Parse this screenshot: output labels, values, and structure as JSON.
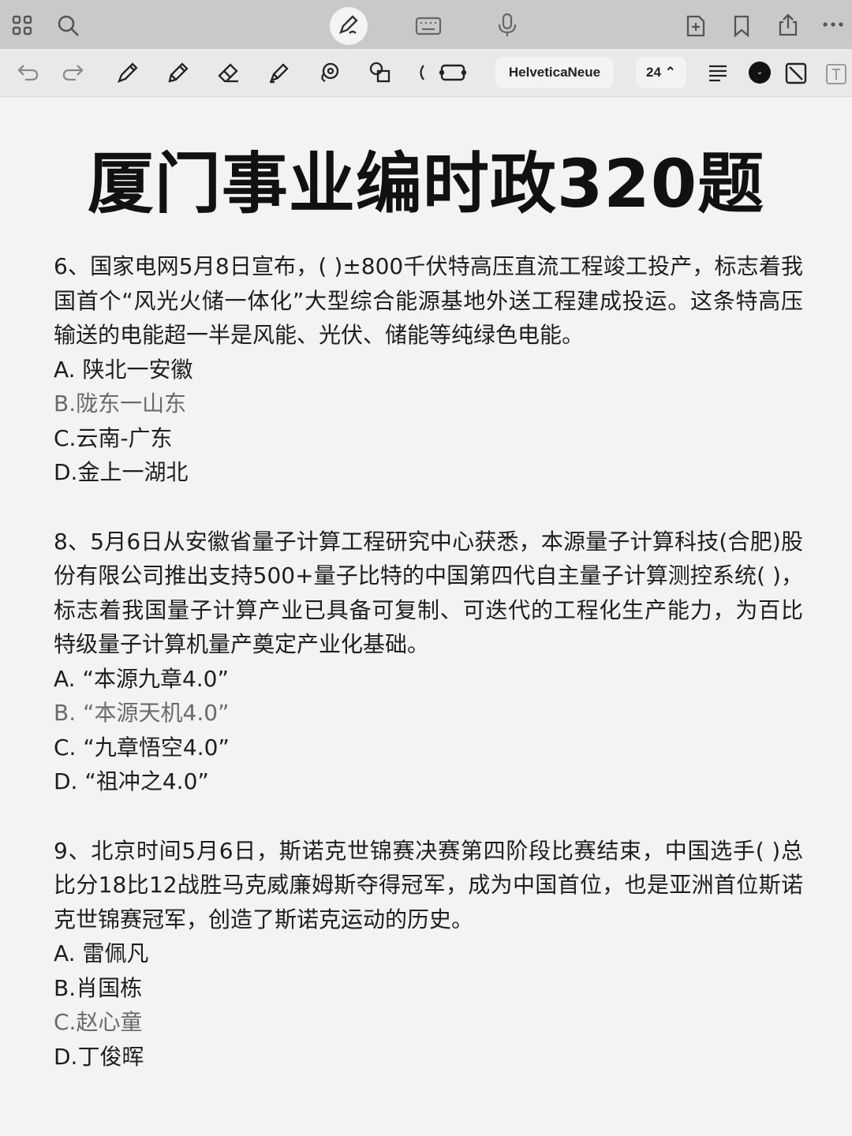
{
  "toolbar": {
    "font_name": "HelveticaNeue",
    "font_size": "24 ⌃",
    "color_indicator": "⌄"
  },
  "document": {
    "title": "厦门事业编时政320题",
    "questions": [
      {
        "text": "6、国家电网5月8日宣布，(   )±800千伏特高压直流工程竣工投产，标志着我国首个“风光火储一体化”大型综合能源基地外送工程建成投运。这条特高压输送的电能超一半是风能、光伏、储能等纯绿色电能。",
        "options": [
          "A. 陕北一安徽",
          "B.陇东一山东",
          "C.云南-广东",
          "D.金上一湖北"
        ]
      },
      {
        "text": "8、5月6日从安徽省量子计算工程研究中心获悉，本源量子计算科技(合肥)股份有限公司推出支持500+量子比特的中国第四代自主量子计算测控系统(   )，标志着我国量子计算产业已具备可复制、可迭代的工程化生产能力，为百比特级量子计算机量产奠定产业化基础。",
        "options": [
          "A. “本源九章4.0”",
          "B. “本源天机4.0”",
          "C. “九章悟空4.0”",
          "D. “祖冲之4.0”"
        ]
      },
      {
        "text": "9、北京时间5月6日，斯诺克世锦赛决赛第四阶段比赛结束，中国选手(     )总比分18比12战胜马克威廉姆斯夺得冠军，成为中国首位，也是亚洲首位斯诺克世锦赛冠军，创造了斯诺克运动的历史。",
        "options": [
          "A. 雷佩凡",
          "B.肖国栋",
          "C.赵心童",
          "D.丁俊晖"
        ]
      }
    ]
  },
  "colors": {
    "text": "#1e1e1e",
    "muted": "#6a6a6a",
    "topbar": "#c9c9c9",
    "toolbar": "#e9e9e9",
    "page": "#f3f3f3"
  }
}
